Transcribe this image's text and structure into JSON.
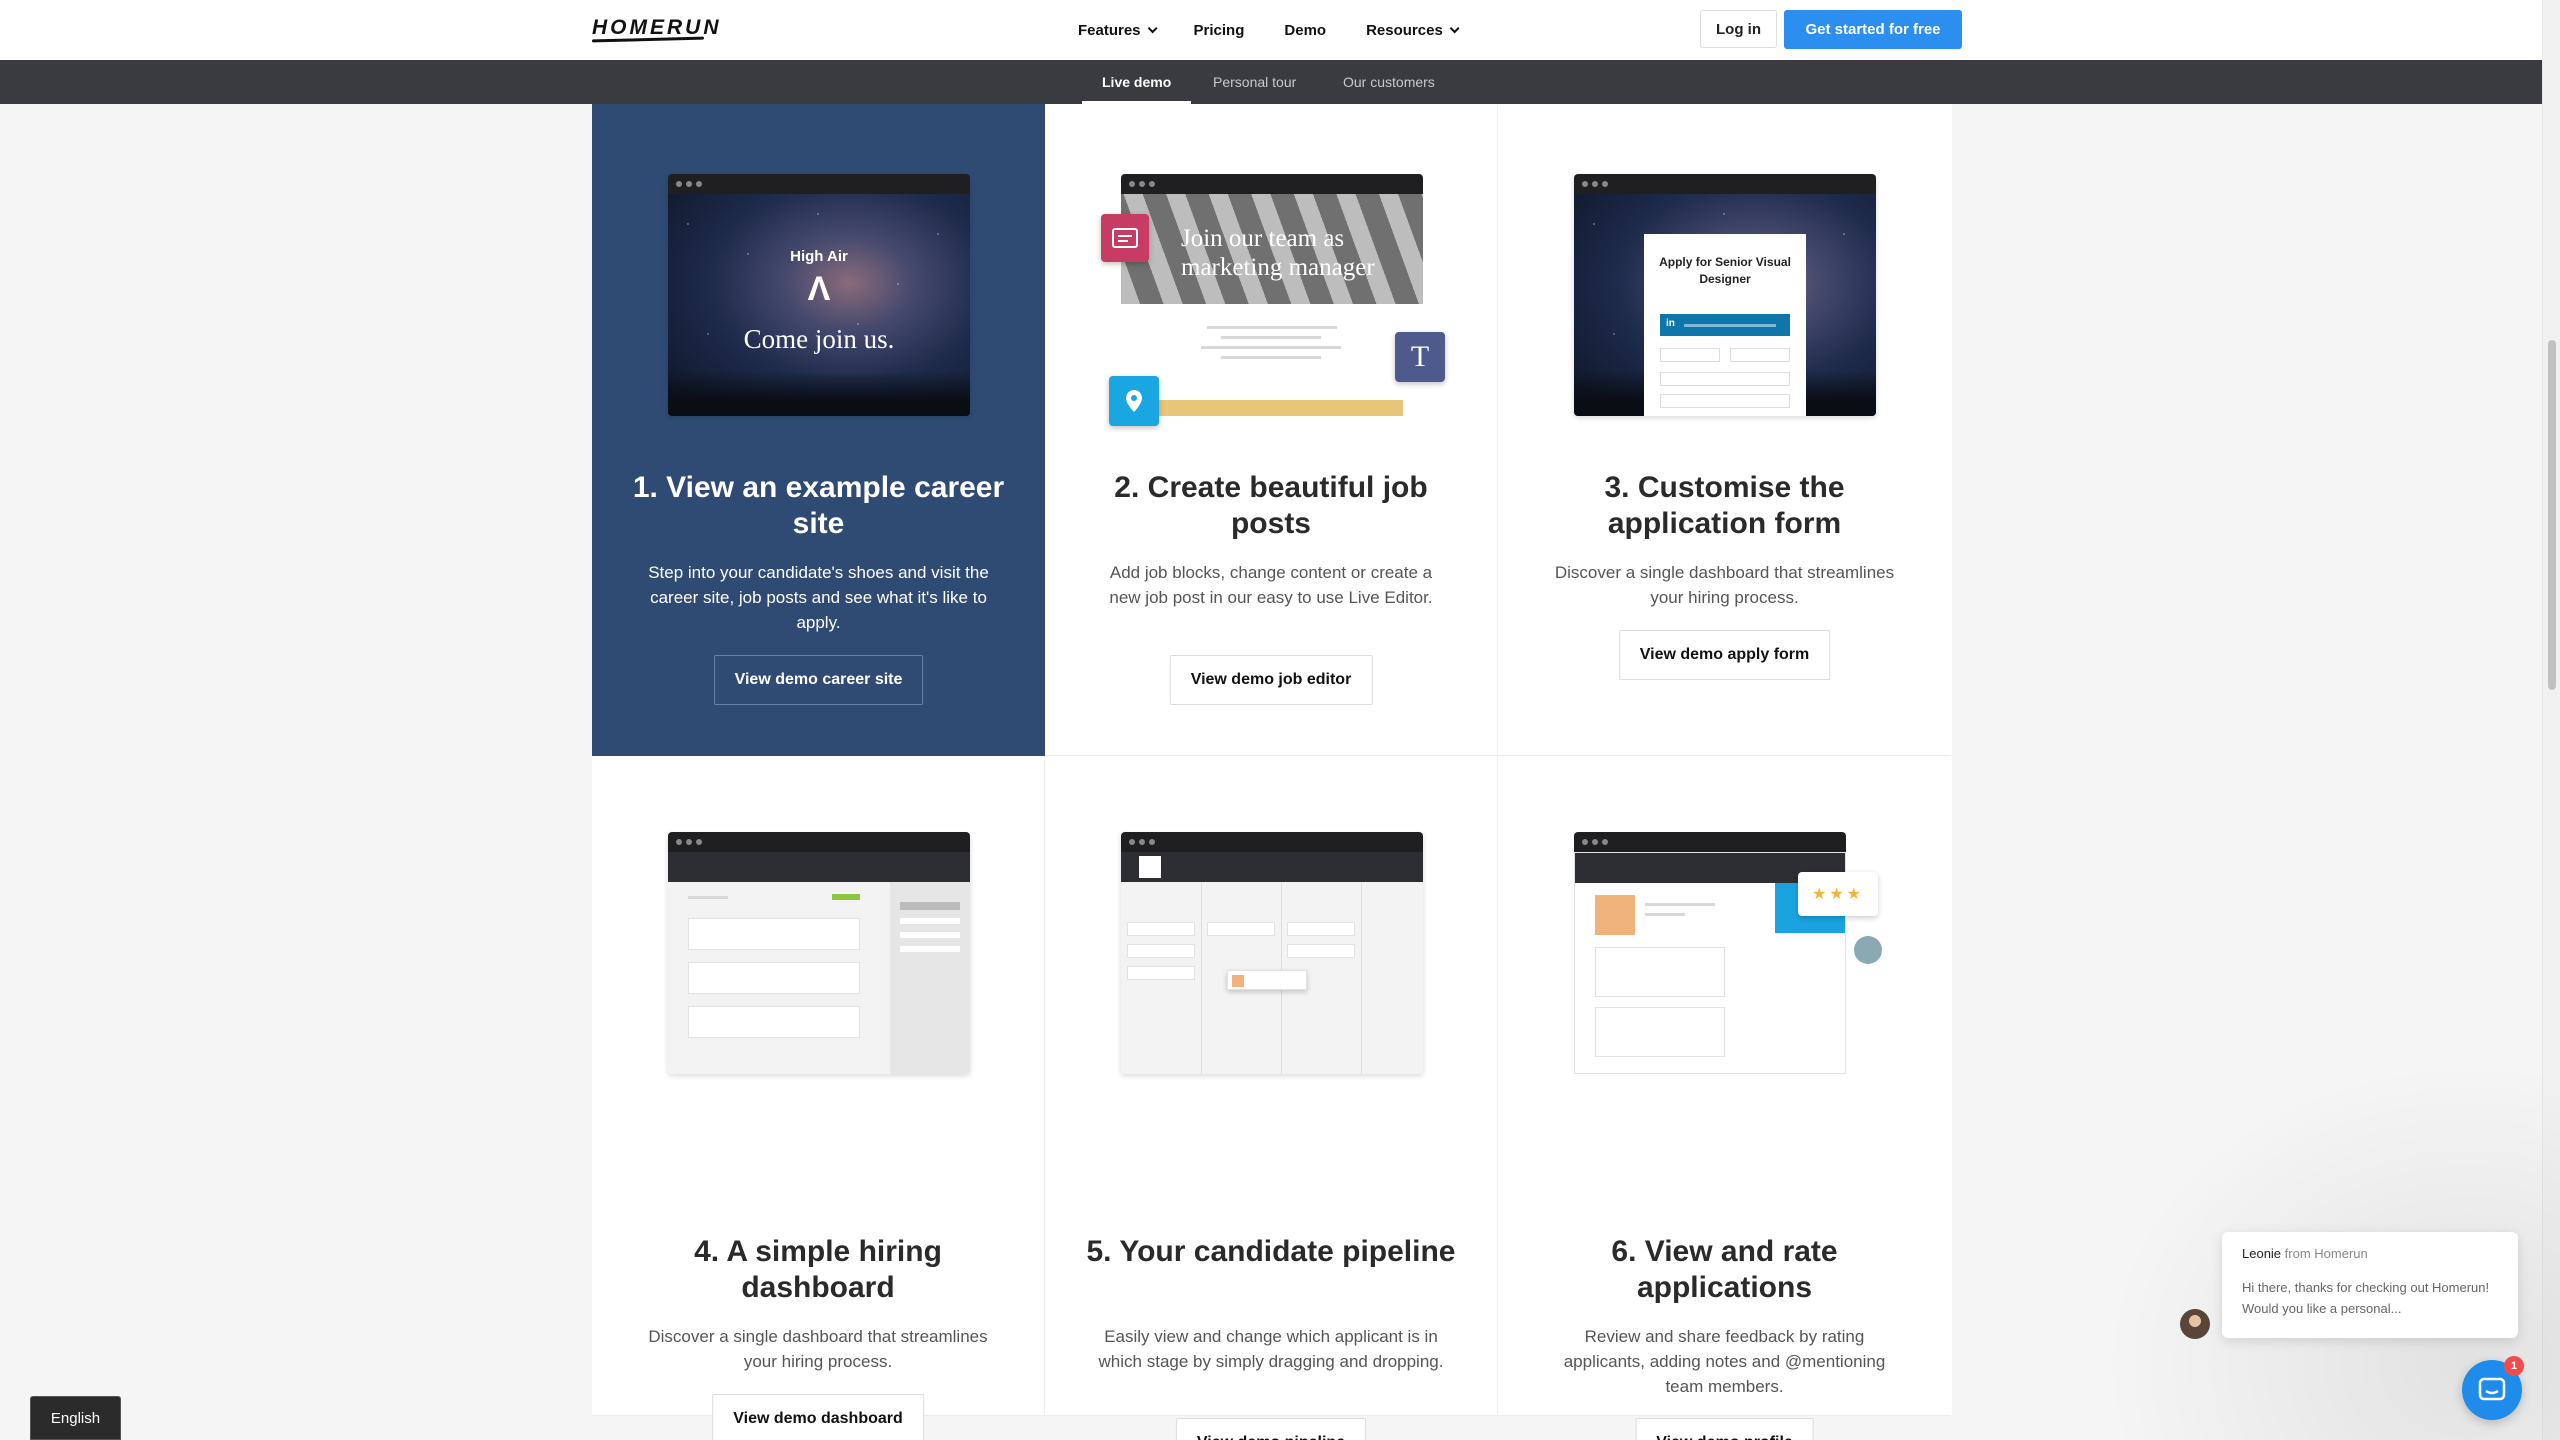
{
  "brand": {
    "logo": "HOMERUN"
  },
  "nav": {
    "items": [
      {
        "label": "Features",
        "dropdown": true
      },
      {
        "label": "Pricing",
        "dropdown": false
      },
      {
        "label": "Demo",
        "dropdown": false
      },
      {
        "label": "Resources",
        "dropdown": true
      }
    ],
    "login_label": "Log in",
    "cta_label": "Get started for free"
  },
  "subnav": {
    "tabs": [
      {
        "label": "Live demo",
        "active": true
      },
      {
        "label": "Personal tour",
        "active": false
      },
      {
        "label": "Our customers",
        "active": false
      }
    ]
  },
  "cards": [
    {
      "title": "1. View an example career site",
      "description": "Step into your candidate's shoes and visit the career site, job posts and see what it's like to apply.",
      "button": "View demo career site",
      "illustration": {
        "brand": "High Air",
        "mark": "Λ",
        "headline": "Come join us."
      }
    },
    {
      "title": "2. Create beautiful job posts",
      "description": "Add job blocks, change content or create a new job post in our easy to use Live Editor.",
      "button": "View demo job editor",
      "illustration": {
        "headline": "Join our team as marketing manager",
        "text_block_letter": "T"
      }
    },
    {
      "title": "3. Customise the application form",
      "description": "Discover a single dashboard that streamlines your hiring process.",
      "button": "View demo apply form",
      "illustration": {
        "form_title": "Apply for Senior Visual Designer",
        "linkedin": "in"
      }
    },
    {
      "title": "4. A simple hiring dashboard",
      "description": "Discover a single dashboard that streamlines your hiring process.",
      "button": "View demo dashboard"
    },
    {
      "title": "5. Your candidate pipeline",
      "description": "Easily view and change which applicant is in which stage by simply dragging and dropping.",
      "button": "View demo pipeline"
    },
    {
      "title": "6. View and rate applications",
      "description": "Review and share feedback by rating applicants, adding notes and @mentioning team members.",
      "button": "View demo profile",
      "illustration": {
        "stars": "★★★"
      }
    }
  ],
  "chat": {
    "sender": "Leonie",
    "from_text": "from Homerun",
    "message": "Hi there, thanks for checking out Homerun! Would you like a personal...",
    "badge_count": "1"
  },
  "language": {
    "label": "English"
  },
  "colors": {
    "featured_bg": "#2f4b73",
    "cta": "#2c8ff0",
    "subnav_bg": "#3a3b3f",
    "chat": "#1f8ceb"
  }
}
